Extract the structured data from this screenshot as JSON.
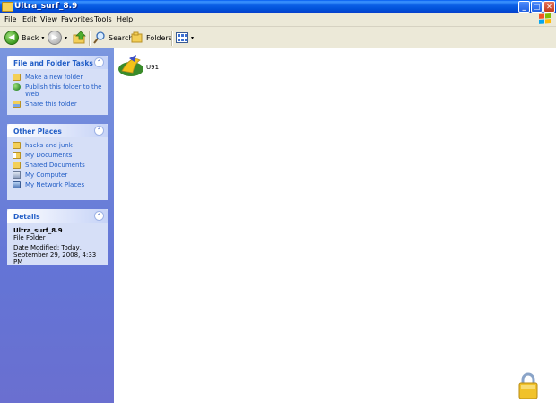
{
  "window": {
    "title": "Ultra_surf_8.9",
    "minimize": "_",
    "maximize": "□",
    "close": "✕"
  },
  "menu": [
    "File",
    "Edit",
    "View",
    "Favorites",
    "Tools",
    "Help"
  ],
  "toolbar": {
    "back_label": "Back",
    "back_glyph": "◀",
    "forward_glyph": "▶",
    "search_label": "Search",
    "folders_label": "Folders",
    "dropdown_glyph": "▾"
  },
  "panels": {
    "file_tasks": {
      "title": "File and Folder Tasks",
      "collapse_glyph": "⌃",
      "items": [
        "Make a new folder",
        "Publish this folder to the Web",
        "Share this folder"
      ]
    },
    "other_places": {
      "title": "Other Places",
      "collapse_glyph": "⌃",
      "items": [
        "hacks and junk",
        "My Documents",
        "Shared Documents",
        "My Computer",
        "My Network Places"
      ]
    },
    "details": {
      "title": "Details",
      "collapse_glyph": "⌃",
      "name": "Ultra_surf_8.9",
      "type": "File Folder",
      "modified": "Date Modified: Today, September 29, 2008, 4:33 PM"
    }
  },
  "files": [
    {
      "name": "U91",
      "icon": "ultrasurf-app-icon"
    }
  ],
  "colors": {
    "titlebar": "#0a5fe5",
    "sidebar": "#6375d6",
    "link": "#215dc6"
  }
}
